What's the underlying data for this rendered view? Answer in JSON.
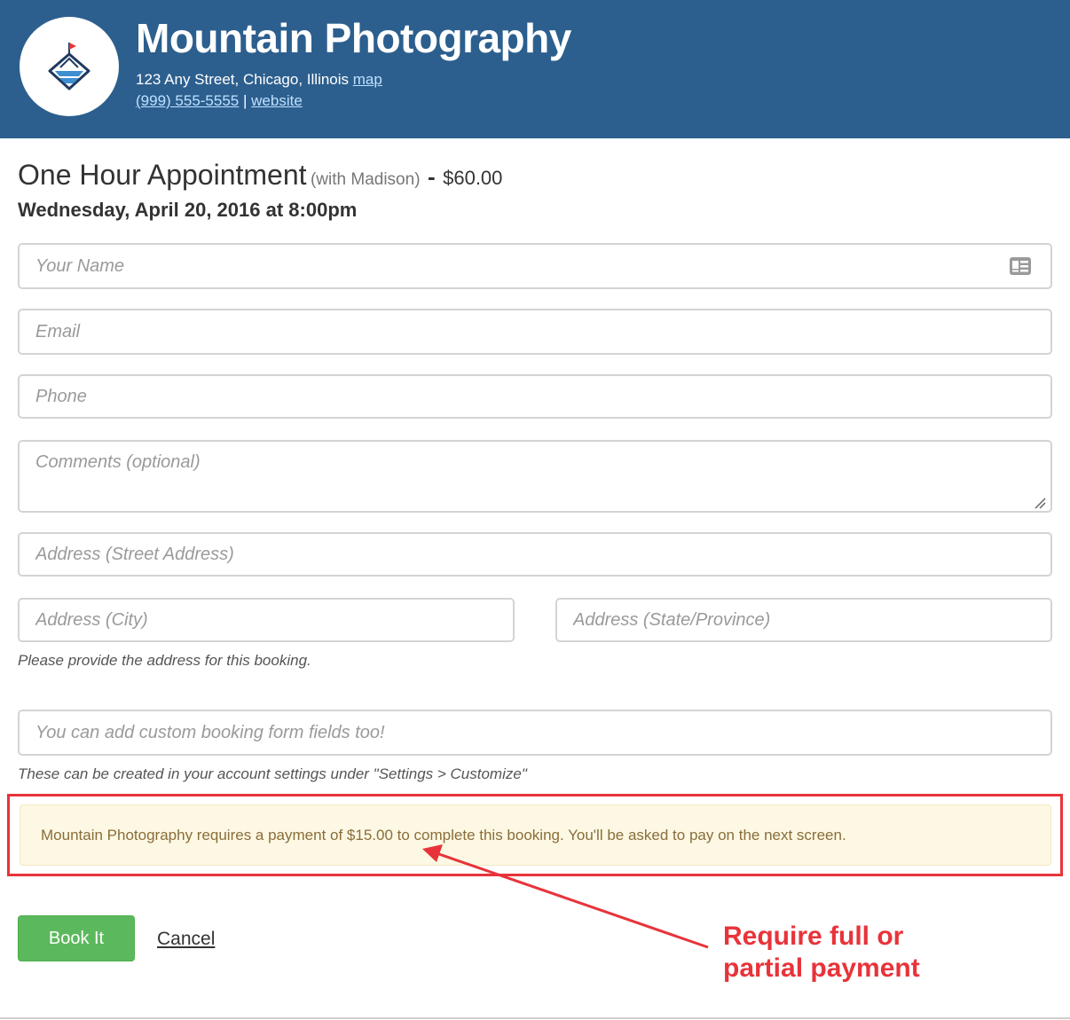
{
  "business": {
    "name": "Mountain Photography",
    "address": "123 Any Street, Chicago, Illinois",
    "map_link": "map",
    "phone": "(999) 555-5555",
    "separator": "|",
    "website_link": "website",
    "logo_icon": "mountain-flag-logo-icon"
  },
  "appointment": {
    "title": "One Hour Appointment",
    "with": "(with Madison)",
    "dash": "-",
    "price": "$60.00",
    "datetime": "Wednesday, April 20, 2016 at 8:00pm"
  },
  "form": {
    "name_placeholder": "Your Name",
    "email_placeholder": "Email",
    "phone_placeholder": "Phone",
    "comments_placeholder": "Comments (optional)",
    "street_placeholder": "Address (Street Address)",
    "city_placeholder": "Address (City)",
    "state_placeholder": "Address (State/Province)",
    "address_help": "Please provide the address for this booking.",
    "custom_placeholder": "You can add custom booking form fields too!",
    "custom_help": "These can be created in your account settings under \"Settings > Customize\""
  },
  "notice": {
    "text": "Mountain Photography requires a payment of $15.00 to complete this booking. You'll be asked to pay on the next screen."
  },
  "actions": {
    "book_label": "Book It",
    "cancel_label": "Cancel"
  },
  "annotation": {
    "line1": "Require full or",
    "line2": "partial payment"
  },
  "colors": {
    "header_bg": "#2c5f8e",
    "book_button": "#5cb85c",
    "notice_bg": "#fcf8e3",
    "notice_text": "#8a6d3b",
    "annotation_red": "#e8333a"
  }
}
